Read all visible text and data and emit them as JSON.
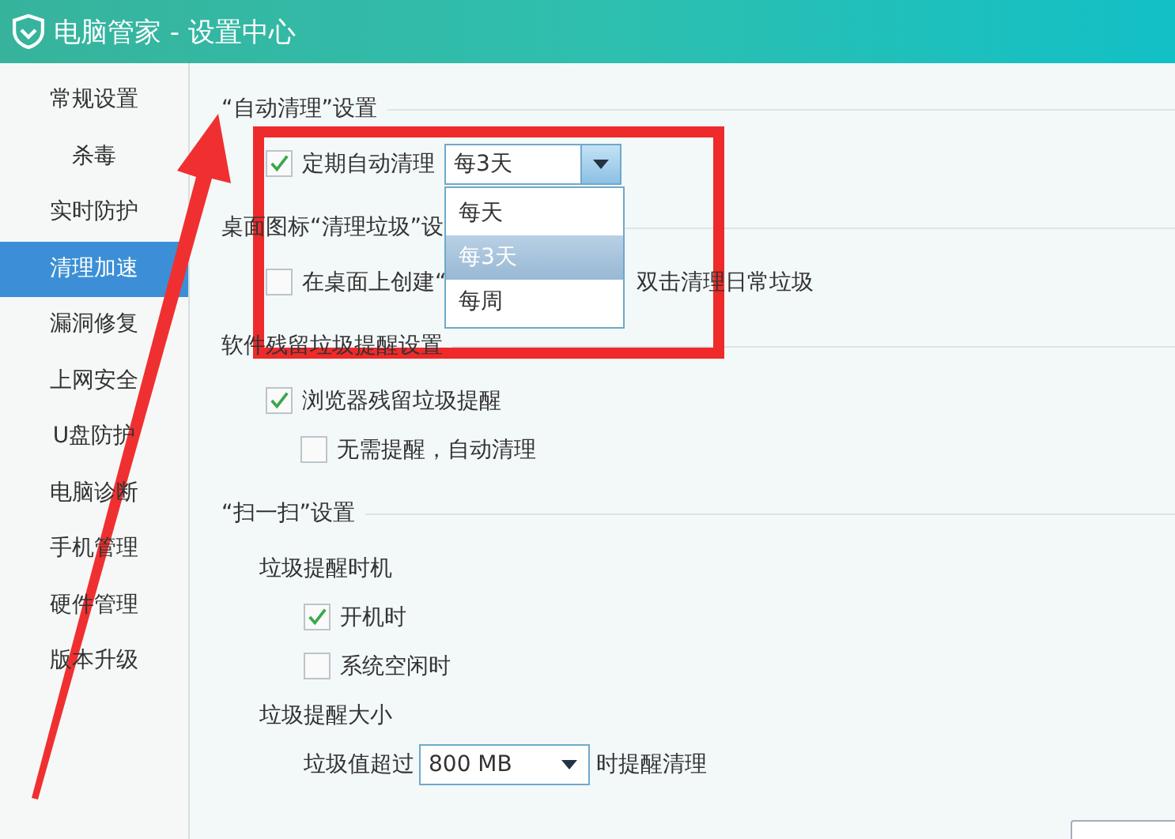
{
  "window": {
    "title": "电脑管家 - 设置中心"
  },
  "sidebar": {
    "items": [
      {
        "label": "常规设置",
        "selected": false
      },
      {
        "label": "杀毒",
        "selected": false
      },
      {
        "label": "实时防护",
        "selected": false
      },
      {
        "label": "清理加速",
        "selected": true
      },
      {
        "label": "漏洞修复",
        "selected": false
      },
      {
        "label": "上网安全",
        "selected": false
      },
      {
        "label": "U盘防护",
        "selected": false
      },
      {
        "label": "电脑诊断",
        "selected": false
      },
      {
        "label": "手机管理",
        "selected": false
      },
      {
        "label": "硬件管理",
        "selected": false
      },
      {
        "label": "版本升级",
        "selected": false
      }
    ]
  },
  "sections": [
    {
      "heading": "“自动清理”设置",
      "rows": [
        {
          "kind": "check-select",
          "label": "定期自动清理",
          "checked": true,
          "select": {
            "value": "每3天",
            "expanded": true,
            "options": [
              {
                "label": "每天",
                "selected": false
              },
              {
                "label": "每3天",
                "selected": true
              },
              {
                "label": "每周",
                "selected": false
              }
            ]
          }
        }
      ]
    },
    {
      "heading": "桌面图标“清理垃圾”设",
      "rows": [
        {
          "kind": "check",
          "label": "在桌面上创建“",
          "checked": false,
          "trailing": "双击清理日常垃圾"
        }
      ]
    },
    {
      "heading": "软件残留垃圾提醒设置",
      "rows": [
        {
          "kind": "check",
          "label": "浏览器残留垃圾提醒",
          "checked": true,
          "children": [
            {
              "kind": "check",
              "label": "无需提醒，自动清理",
              "checked": false
            }
          ]
        }
      ]
    },
    {
      "heading": "“扫一扫”设置",
      "rows": [
        {
          "kind": "group",
          "label": "垃圾提醒时机",
          "children": [
            {
              "kind": "check",
              "label": "开机时",
              "checked": true
            },
            {
              "kind": "check",
              "label": "系统空闲时",
              "checked": false
            }
          ]
        },
        {
          "kind": "group",
          "label": "垃圾提醒大小",
          "children": [
            {
              "kind": "size",
              "label": "垃圾值超过",
              "select": {
                "value": "800 MB",
                "expanded": false
              },
              "trailing": "时提醒清理"
            }
          ]
        }
      ]
    }
  ]
}
